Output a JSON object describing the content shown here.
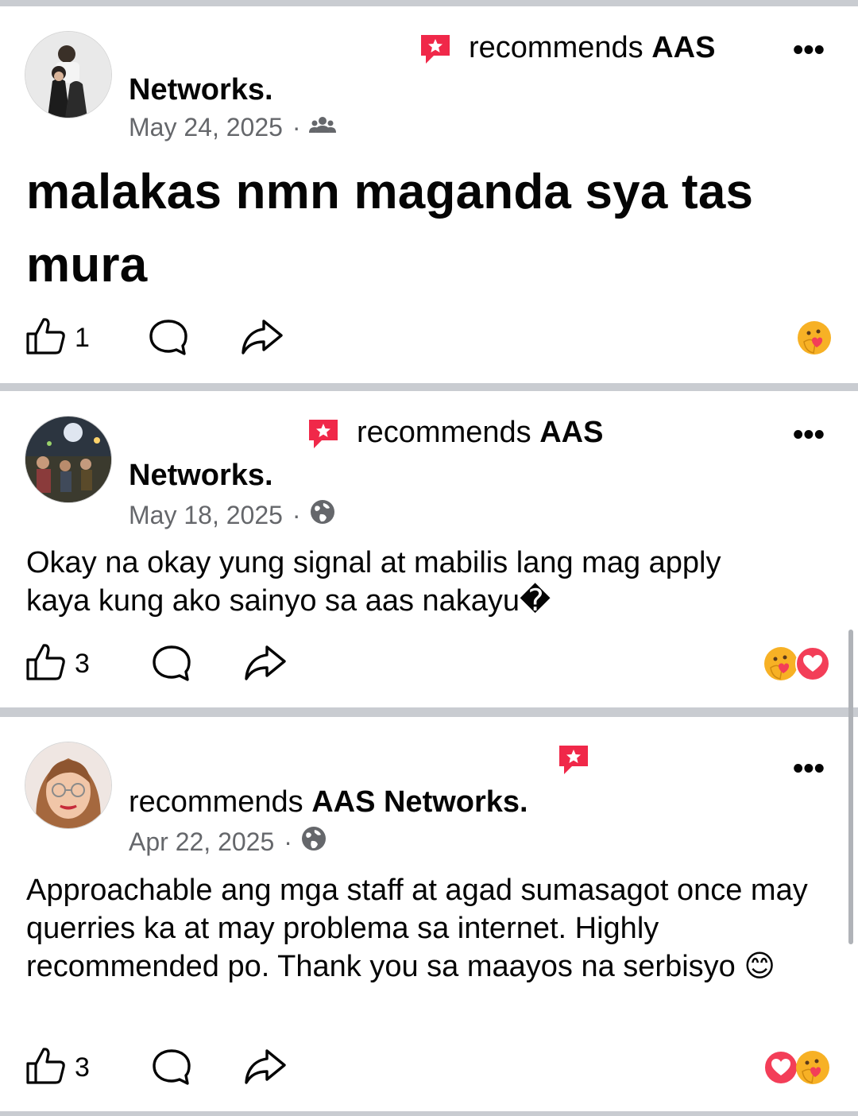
{
  "posts": [
    {
      "recommends_text": "recommends",
      "page_name_part": "AAS",
      "name_line": "Networks.",
      "date": "May 24, 2025",
      "audience_icon": "friends-icon",
      "text": "malakas nmn maganda sya tas mura",
      "like_count": "1",
      "reactions": [
        "care"
      ]
    },
    {
      "recommends_text": "recommends",
      "page_name_part": "AAS",
      "name_line": "Networks.",
      "date": "May 18, 2025",
      "audience_icon": "globe-icon",
      "text": "Okay na okay yung signal at mabilis lang mag apply kaya kung ako sainyo sa aas nakayu�",
      "like_count": "3",
      "reactions": [
        "care",
        "love"
      ]
    },
    {
      "recommends_text": "recommends",
      "page_name_part": "AAS Networks.",
      "date": "Apr 22, 2025",
      "audience_icon": "globe-icon",
      "text": "Approachable ang mga staff at agad sumasagot once may querries ka at may problema sa internet. Highly recommended po. Thank you sa maayos na serbisyo 😊",
      "like_count": "3",
      "reactions": [
        "love",
        "care"
      ]
    }
  ],
  "colors": {
    "recommend_badge": "#f02849",
    "divider": "#c9ccd1",
    "meta_text": "#65676b",
    "love": "#f33e58",
    "care": "#f7b125"
  }
}
